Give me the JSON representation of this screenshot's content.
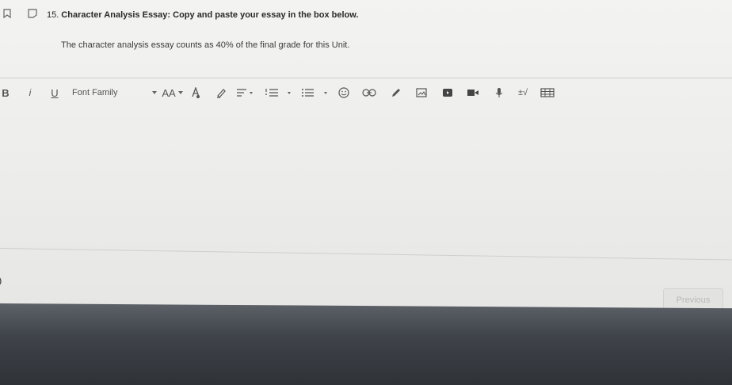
{
  "question": {
    "number": "15.",
    "title": "Character Analysis Essay: Copy and paste your essay in the box below.",
    "description": "The character analysis essay counts as 40% of the final grade for this Unit."
  },
  "toolbar": {
    "bold_label": "B",
    "italic_label": "i",
    "underline_label": "U",
    "font_family_label": "Font Family",
    "font_size_label": "AA",
    "math_label": "±√",
    "icons": [
      "bold-icon",
      "italic-icon",
      "underline-icon",
      "font-family-select",
      "font-size-icon",
      "text-color-icon",
      "highlight-icon",
      "align-icon",
      "ordered-list-icon",
      "bullet-list-icon",
      "emoji-icon",
      "link-icon",
      "draw-icon",
      "image-icon",
      "video-icon",
      "record-video-icon",
      "microphone-icon",
      "math-icon",
      "table-icon"
    ]
  },
  "editor": {
    "value": ""
  },
  "navigation": {
    "previous_label": "Previous"
  }
}
